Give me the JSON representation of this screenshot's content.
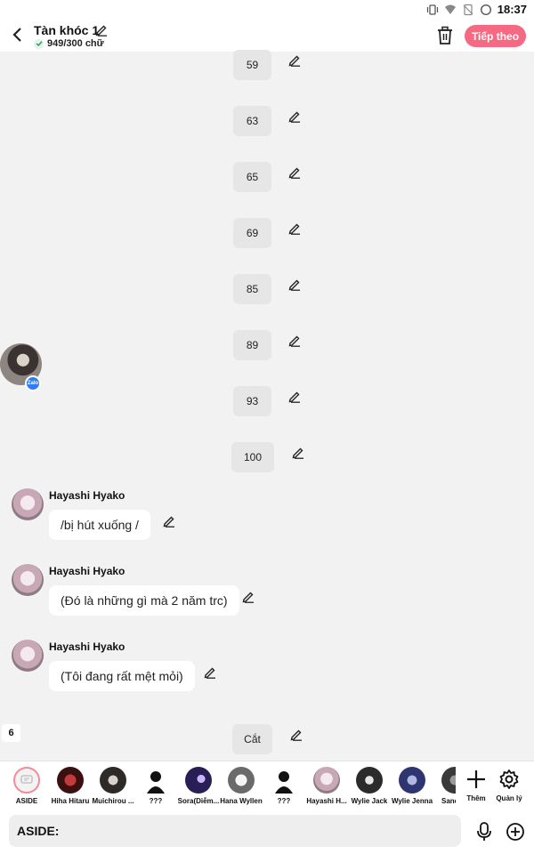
{
  "status_bar": {
    "time": "18:37"
  },
  "header": {
    "title": "Tàn khóc 1",
    "word_count": "949/300 chữ",
    "next_label": "Tiếp theo"
  },
  "messages": {
    "numbers": [
      "59",
      "63",
      "65",
      "69",
      "85",
      "89",
      "93",
      "100"
    ],
    "chat": [
      {
        "name": "Hayashi Hyako",
        "text": "/bị hút xuống /"
      },
      {
        "name": "Hayashi Hyako",
        "text": "(Đó là những gì mà 2 năm trc)"
      },
      {
        "name": "Hayashi Hyako",
        "text": "(Tôi đang rất mệt mỏi)"
      }
    ],
    "cut_label": "Cắt",
    "side_badge": "6",
    "zalo_badge": "Zalo"
  },
  "characters": [
    "ASIDE",
    "Hiha Hitaru",
    "Muichirou ...",
    "???",
    "Sora(Diễm...",
    "Hana Wyllen",
    "???",
    "Hayashi H...",
    "Wylie Jack",
    "Wylie Jenna",
    "Sand"
  ],
  "toolbar": {
    "add_label": "Thêm",
    "manage_label": "Quản lý"
  },
  "input": {
    "value": "ASIDE:"
  },
  "colors": {
    "accent": "#f56a82",
    "badge": "#2f7cf6"
  }
}
